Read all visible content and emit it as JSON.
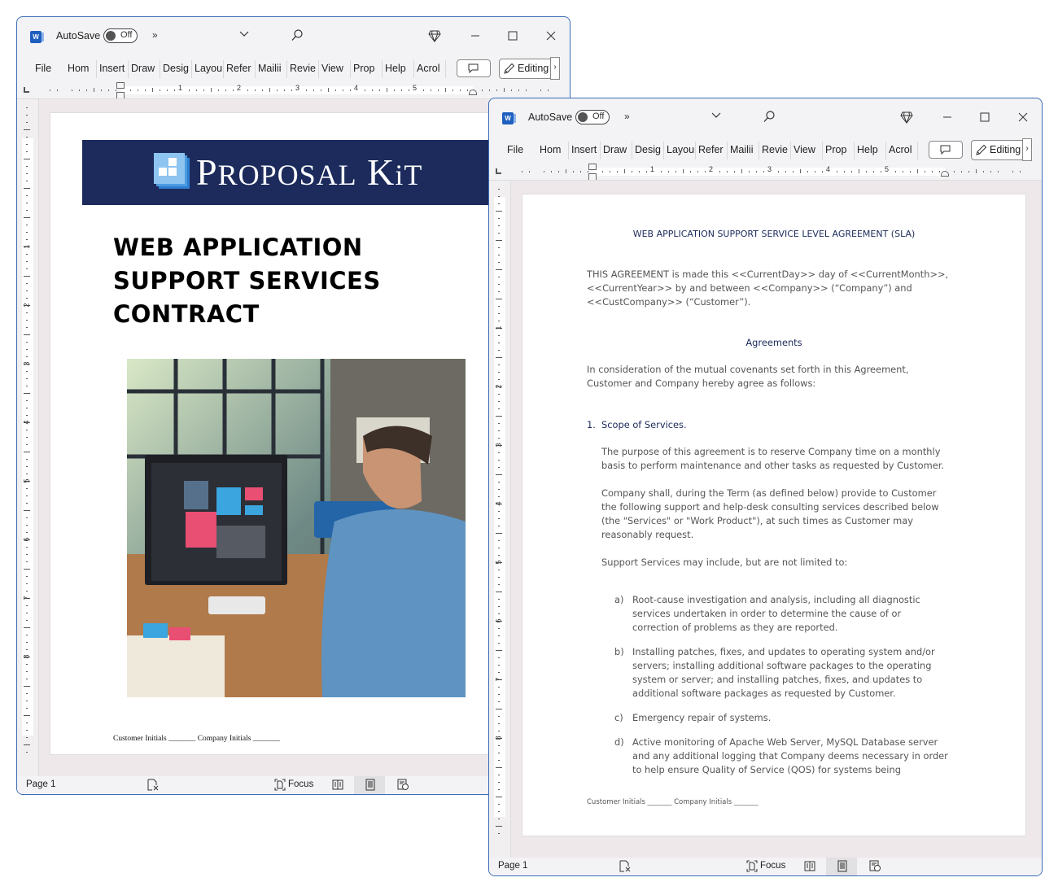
{
  "app": {
    "autosave_label": "AutoSave",
    "autosave_state": "Off",
    "overflow": "»",
    "title_dropdown": "⌄",
    "ribbon_tabs": [
      "File",
      "Home",
      "Insert",
      "Draw",
      "Design",
      "Layout",
      "References",
      "Mailings",
      "Review",
      "View",
      "Properties",
      "Help",
      "Acrobat"
    ],
    "ribbon_tabs_display": [
      "File",
      "Hom",
      "Insert",
      "Draw",
      "Desig",
      "Layou",
      "Refer",
      "Mailii",
      "Revie",
      "View",
      "Prop",
      "Help",
      "Acrol"
    ],
    "editing_label": "Editing",
    "editing_more": "›",
    "ruler_numbers": [
      "1",
      "2",
      "3",
      "4",
      "5"
    ],
    "vruler_numbers": [
      "1",
      "2",
      "3",
      "4",
      "5",
      "6",
      "7",
      "8"
    ],
    "status_page": "Page 1",
    "focus_label": "Focus",
    "accent_color": "#1c2b5c"
  },
  "window1": {
    "banner": {
      "logo_text_p": "P",
      "logo_text_roposal": "ROPOSAL",
      "logo_text_k": "K",
      "logo_text_it": "iT",
      "brand_color": "#1c2b5c"
    },
    "cover_title_lines": [
      "WEB APPLICATION",
      "SUPPORT SERVICES",
      "CONTRACT"
    ],
    "cover_image_alt": "Man working at a computer with web application design on screen",
    "initials_line": "Customer Initials _______ Company Initials _______"
  },
  "window2": {
    "title": "WEB APPLICATION SUPPORT SERVICE LEVEL AGREEMENT (SLA)",
    "intro_lines": [
      "THIS AGREEMENT is made this <<CurrentDay>> day of <<CurrentMonth>>,",
      "<<CurrentYear>> by and between <<Company>> (“Company”) and",
      "<<CustCompany>> (“Customer”)."
    ],
    "agreements_heading": "Agreements",
    "consideration_lines": [
      "In consideration of the mutual covenants set forth in this Agreement,",
      "Customer and Company hereby agree as follows:"
    ],
    "section1_number": "1.",
    "section1_title": "Scope of Services.",
    "purpose_lines": [
      "The purpose of this agreement is to reserve Company time on a monthly",
      "basis to perform maintenance and other tasks as requested by Customer."
    ],
    "shall_lines": [
      "Company shall, during the Term (as defined below) provide to Customer",
      "the following support and help-desk consulting services described below",
      "(the \"Services\" or \"Work Product\"), at such times as Customer may",
      "reasonably request."
    ],
    "support_intro": "Support Services may include, but are not limited to:",
    "items": [
      {
        "marker": "a)",
        "lines": [
          "Root-cause investigation and analysis, including all diagnostic",
          "services undertaken in order to determine the cause of or",
          "correction of problems as they are reported."
        ]
      },
      {
        "marker": "b)",
        "lines": [
          "Installing patches, fixes, and updates to operating system and/or",
          "servers; installing additional software packages to the operating",
          "system or server; and installing patches, fixes, and updates to",
          "additional software packages as requested by Customer."
        ]
      },
      {
        "marker": "c)",
        "lines": [
          "Emergency repair of systems."
        ]
      },
      {
        "marker": "d)",
        "lines": [
          "Active monitoring of Apache Web Server, MySQL Database server",
          "and any additional logging that Company deems necessary in order",
          "to help ensure Quality of Service (QOS) for systems being"
        ]
      }
    ],
    "initials_line": "Customer Initials _______ Company Initials _______"
  }
}
